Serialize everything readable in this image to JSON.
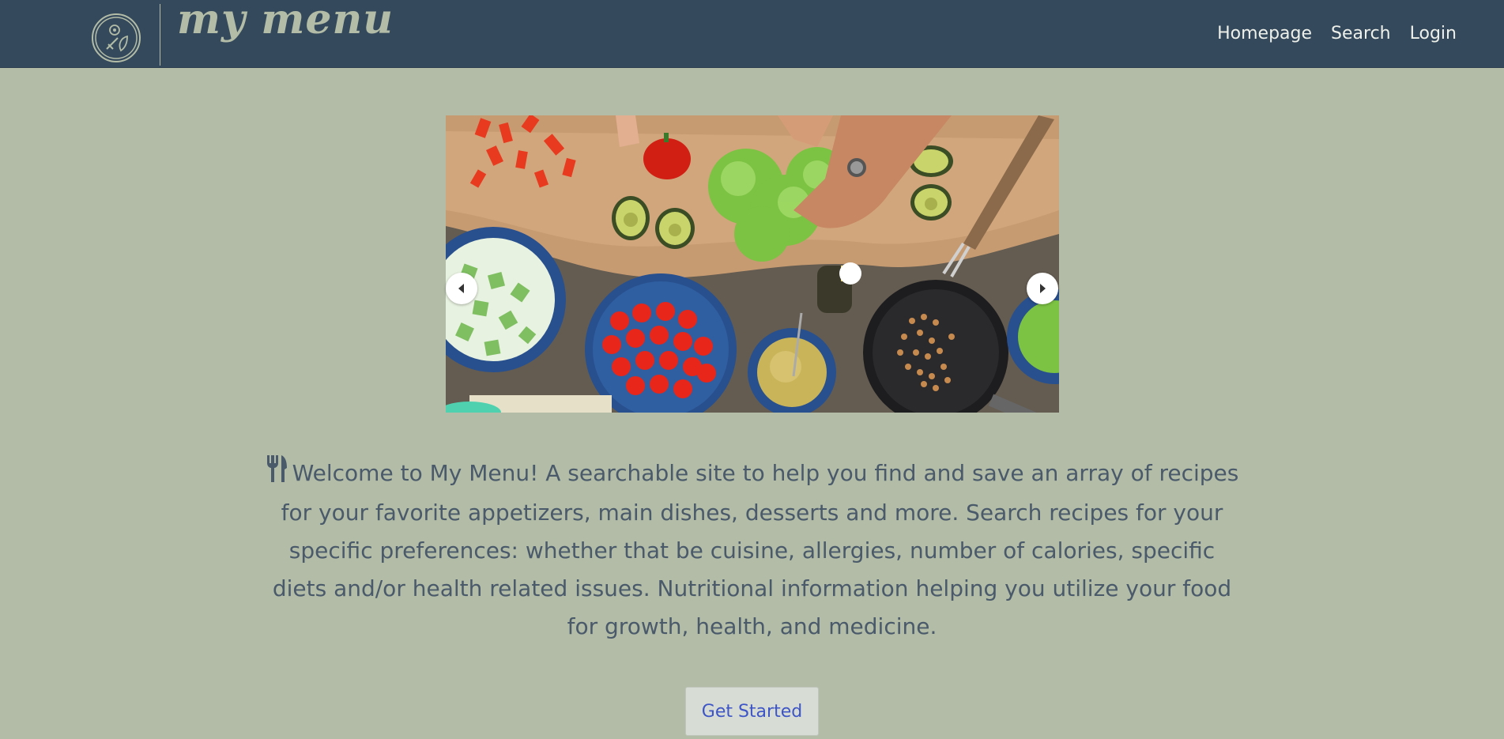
{
  "brand": {
    "logo_text": "my menu",
    "logo_icon": "plate-leaf-icon"
  },
  "nav": {
    "links": [
      "Homepage",
      "Search",
      "Login"
    ]
  },
  "carousel": {
    "prev_icon": "arrow-left-icon",
    "next_icon": "arrow-right-icon"
  },
  "welcome": {
    "icon": "utensils-icon",
    "text": "Welcome to My Menu! A searchable site to help you find and save an array of recipes for your favorite appetizers, main dishes, desserts and more. Search recipes for your specific preferences: whether that be cuisine, allergies, number of calories, specific diets and/or health related issues. Nutritional information helping you utilize your food for growth, health, and medicine."
  },
  "cta": {
    "label": "Get Started"
  },
  "colors": {
    "navbar": "#35495c",
    "background": "#b2bca6",
    "text": "#4a5a6b",
    "link": "#3d55c6"
  }
}
